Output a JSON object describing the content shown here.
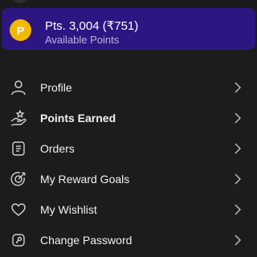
{
  "points": {
    "coin_letter": "P",
    "title": "Pts. 3,004 (₹751)",
    "subtitle": "Available Points",
    "card_color": "#2d1682",
    "coin_color": "#f3b800"
  },
  "menu": {
    "items": [
      {
        "label": "Profile",
        "icon": "person-icon"
      },
      {
        "label": "Points Earned",
        "icon": "hand-star-icon"
      },
      {
        "label": "Orders",
        "icon": "receipt-icon"
      },
      {
        "label": "My Reward Goals",
        "icon": "target-icon"
      },
      {
        "label": "My Wishlist",
        "icon": "heart-icon"
      },
      {
        "label": "Change Password",
        "icon": "key-icon"
      }
    ]
  }
}
